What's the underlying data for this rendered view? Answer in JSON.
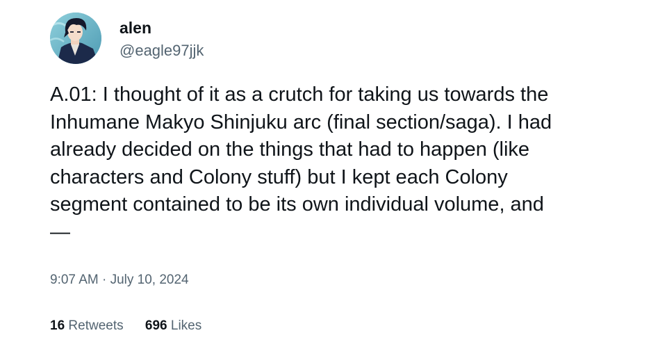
{
  "author": {
    "display_name": "alen",
    "handle": "@eagle97jjk",
    "avatar_icon": "anime-character-avatar"
  },
  "tweet": {
    "text": "A.01: I thought of it as a crutch for taking us towards the\nInhumane Makyo Shinjuku arc (final section/saga). I had\nalready decided on the things that had to happen (like\ncharacters and Colony stuff) but I kept each Colony\nsegment contained to be its own individual volume, and\n—",
    "timestamp": "9:07 AM · July 10, 2024"
  },
  "stats": {
    "retweets_count": "16",
    "retweets_label": "Retweets",
    "likes_count": "696",
    "likes_label": "Likes"
  },
  "colors": {
    "text_primary": "#0f1419",
    "text_secondary": "#536471",
    "background": "#ffffff"
  }
}
